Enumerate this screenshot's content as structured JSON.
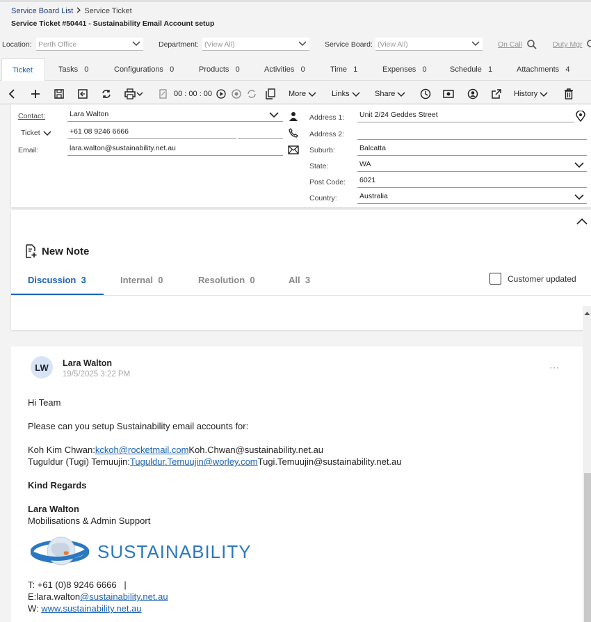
{
  "breadcrumb": {
    "list": "Service Board List",
    "current": "Service Ticket"
  },
  "title": "Service Ticket #50441 - Sustainability Email Account setup",
  "filters": {
    "location_label": "Location:",
    "location_value": "Perth Office",
    "department_label": "Department:",
    "department_value": "(View All)",
    "board_label": "Service Board:",
    "board_value": "(View All)",
    "on_call": "On Call",
    "duty_mgr": "Duty Mgr"
  },
  "tabs": [
    {
      "label": "Ticket",
      "count": ""
    },
    {
      "label": "Tasks",
      "count": "0"
    },
    {
      "label": "Configurations",
      "count": "0"
    },
    {
      "label": "Products",
      "count": "0"
    },
    {
      "label": "Activities",
      "count": "0"
    },
    {
      "label": "Time",
      "count": "1"
    },
    {
      "label": "Expenses",
      "count": "0"
    },
    {
      "label": "Schedule",
      "count": "1"
    },
    {
      "label": "Attachments",
      "count": "4"
    }
  ],
  "toolbar": {
    "timer": "00 : 00 : 00",
    "more": "More",
    "links": "Links",
    "share": "Share",
    "history": "History"
  },
  "contact": {
    "contact_label": "Contact:",
    "contact_value": "Lara Walton",
    "ticket_label": "Ticket",
    "phone_value": "+61 08 9246 6666",
    "email_label": "Email:",
    "email_value": "lara.walton@sustainability.net.au"
  },
  "address": {
    "address1_label": "Address 1:",
    "address1_value": "Unit 2/24 Geddes Street",
    "address2_label": "Address 2:",
    "address2_value": "",
    "suburb_label": "Suburb:",
    "suburb_value": "Balcatta",
    "state_label": "State:",
    "state_value": "WA",
    "postcode_label": "Post Code:",
    "postcode_value": "6021",
    "country_label": "Country:",
    "country_value": "Australia"
  },
  "notes": {
    "new_note": "New Note",
    "tabs": [
      {
        "label": "Discussion",
        "count": "3"
      },
      {
        "label": "Internal",
        "count": "0"
      },
      {
        "label": "Resolution",
        "count": "0"
      },
      {
        "label": "All",
        "count": "3"
      }
    ],
    "customer_updated": "Customer updated"
  },
  "message": {
    "initials": "LW",
    "author": "Lara Walton",
    "timestamp": "19/5/2025 3:22 PM",
    "greeting": "Hi Team",
    "body": "Please can you setup Sustainability email accounts for:",
    "line1_prefix": "Koh Kim Chwan:",
    "line1_link": "kckoh@rocketmail.com",
    "line1_suffix": "Koh.Chwan@sustainability.net.au",
    "line2_prefix": "Tuguldur (Tugi) Temuujin:",
    "line2_link": "Tuguldur.Temuujin@worley.com",
    "line2_suffix": "Tugi.Temuujin@sustainability.net.au",
    "regards": "Kind Regards",
    "sig_name": "Lara Walton",
    "sig_role": "Mobilisations & Admin Support",
    "logo_text": "SUSTAINABILITY",
    "phone_line": "T: +61 (0)8 9246 6666   |",
    "email_prefix": "E:lara.walton",
    "email_link": "@sustainability.net.au",
    "web_prefix": "W: ",
    "web_link": "www.sustainability.net.au"
  },
  "colors": {
    "accent": "#1a62b4",
    "logo": "#2a78bf"
  }
}
